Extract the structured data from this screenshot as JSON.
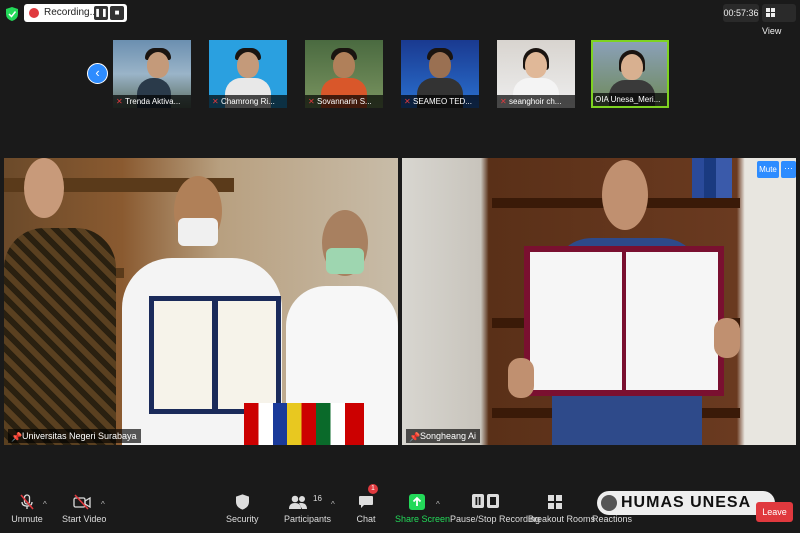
{
  "recording": {
    "label": "Recording..."
  },
  "meeting": {
    "timer": "00:57:36",
    "view_label": "View"
  },
  "participants_strip": [
    {
      "name": "Trenda Aktiva..."
    },
    {
      "name": "Chamrong Ri..."
    },
    {
      "name": "Sovannarin S..."
    },
    {
      "name": "SEAMEO TED..."
    },
    {
      "name": "seanghoir ch..."
    },
    {
      "name": "OIA Unesa_Meri..."
    }
  ],
  "main_tiles": [
    {
      "name": "Universitas Negeri Surabaya"
    },
    {
      "name": "Songheang Ai"
    }
  ],
  "tile_controls": {
    "mute_label": "Mute",
    "more_label": "···"
  },
  "toolbar": {
    "unmute": "Unmute",
    "start_video": "Start Video",
    "security": "Security",
    "participants": "Participants",
    "participants_count": "16",
    "chat": "Chat",
    "chat_badge": "1",
    "share_screen": "Share Screen",
    "pause_recording": "Pause/Stop Recording",
    "breakout_rooms": "Breakout Rooms",
    "reactions": "Reactions",
    "leave": "Leave"
  },
  "watermark": {
    "text": "HUMAS UNESA"
  },
  "colors": {
    "accent_blue": "#2d8cff",
    "danger_red": "#e0393e",
    "share_green": "#23d959"
  }
}
